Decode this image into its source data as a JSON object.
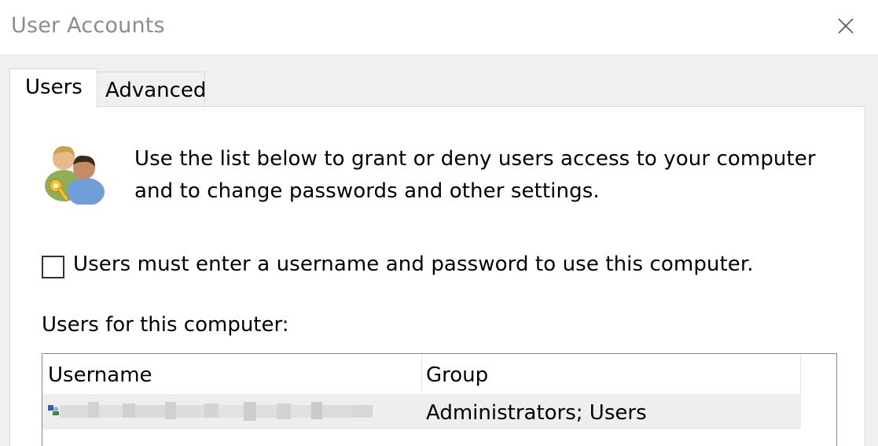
{
  "window": {
    "title": "User Accounts",
    "close_icon": "close-icon"
  },
  "tabs": [
    {
      "label": "Users",
      "selected": true
    },
    {
      "label": "Advanced",
      "selected": false
    }
  ],
  "users_tab": {
    "icon": "users-key-icon",
    "intro_line1": "Use the list below to grant or deny users access to your computer",
    "intro_line2": "and to change passwords and other settings.",
    "checkbox_label": "Users must enter a username and password to use this computer.",
    "checkbox_checked": false,
    "list_caption": "Users for this computer:",
    "columns": {
      "username": "Username",
      "group": "Group"
    },
    "rows": [
      {
        "username": "",
        "username_obscured": true,
        "group": "Administrators; Users",
        "icon": "user-account-icon"
      }
    ]
  }
}
